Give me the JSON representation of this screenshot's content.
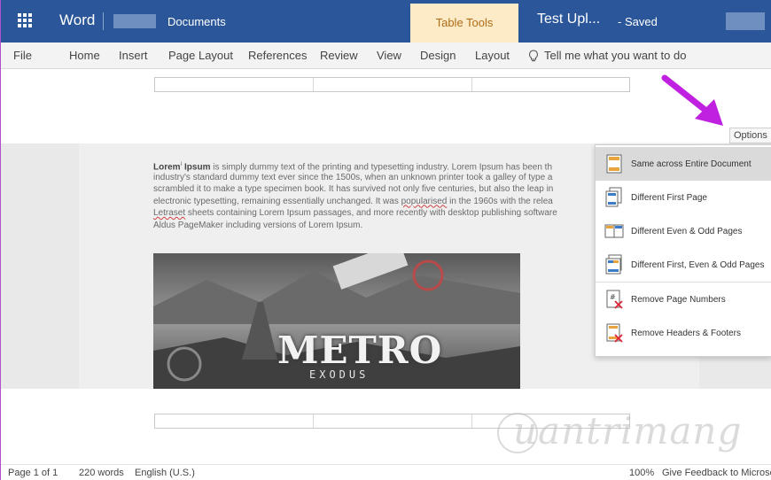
{
  "titlebar": {
    "app_name": "Word",
    "breadcrumb": "Documents",
    "contextual_tab": "Table Tools",
    "doc_title": "Test Upl...",
    "save_status": "-  Saved",
    "colors": {
      "bar": "#2b579a",
      "contextual": "#fdebc7"
    }
  },
  "ribbon": {
    "tabs": [
      "File",
      "Home",
      "Insert",
      "Page Layout",
      "References",
      "Review",
      "View",
      "Design",
      "Layout"
    ],
    "tell_me": "Tell me what you want to do"
  },
  "document": {
    "paragraph": {
      "lead": "Lorem",
      "superscript": "I",
      "lead_rest": " Ipsum",
      "line1": " is simply dummy text of the printing and typesetting industry. Lorem Ipsum has been th",
      "line2": "industry's standard dummy text ever since the 1500s, when an unknown printer took a galley of type a",
      "line3": "scrambled it to make a type specimen book. It has survived not only five centuries, but also the leap in",
      "line4a": "electronic typesetting, remaining essentially unchanged. It was ",
      "line4b": "popularised",
      "line4c": " in the 1960s with the relea",
      "line5a": "Letraset",
      "line5b": " sheets containing Lorem Ipsum passages, and more recently with desktop publishing software",
      "line6": "Aldus PageMaker including versions of Lorem Ipsum."
    },
    "image": {
      "title": "METRO",
      "subtitle": "EXODUS"
    }
  },
  "options": {
    "button_label": "Options ⌄",
    "items": [
      {
        "label": "Same across Entire Document",
        "icon": "same-page-icon",
        "selected": true
      },
      {
        "label": "Different First Page",
        "icon": "first-page-icon",
        "selected": false
      },
      {
        "label": "Different Even & Odd Pages",
        "icon": "even-odd-icon",
        "selected": false
      },
      {
        "label": "Different First, Even & Odd Pages",
        "icon": "first-even-odd-icon",
        "selected": false
      },
      {
        "label": "Remove Page Numbers",
        "icon": "remove-page-numbers-icon",
        "selected": false
      },
      {
        "label": "Remove Headers & Footers",
        "icon": "remove-headers-footers-icon",
        "selected": false
      }
    ]
  },
  "watermark": "uantrimang",
  "statusbar": {
    "page": "Page 1 of 1",
    "words": "220 words",
    "language": "English (U.S.)",
    "zoom": "100%",
    "feedback": "Give Feedback to Microsoft"
  },
  "annotation": {
    "arrow_color": "#c020e0"
  }
}
